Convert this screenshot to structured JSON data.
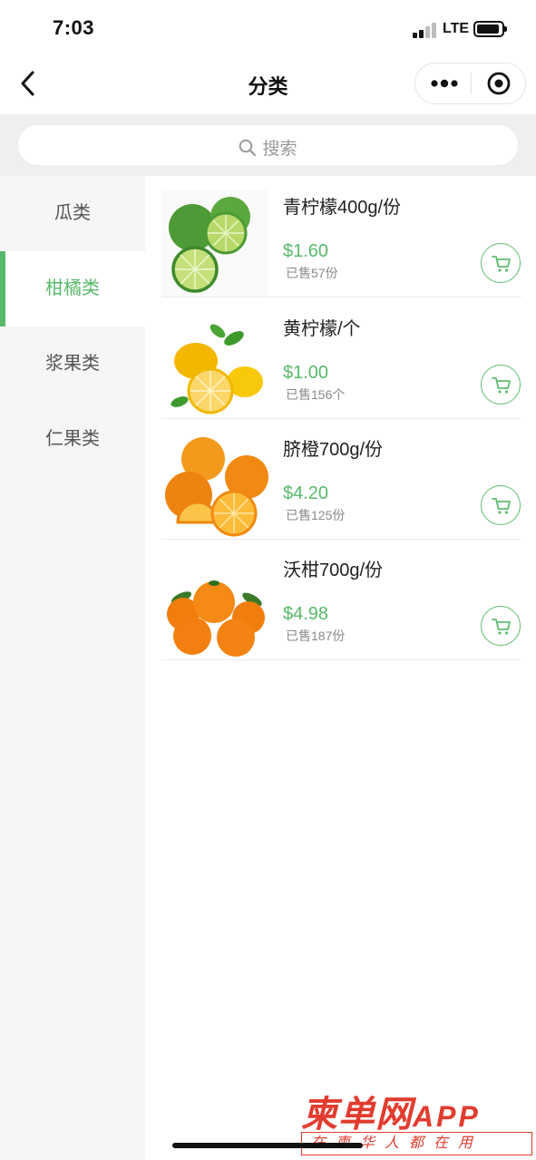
{
  "status_bar": {
    "time": "7:03",
    "network": "LTE"
  },
  "nav": {
    "title": "分类"
  },
  "search": {
    "placeholder": "搜索"
  },
  "categories": [
    {
      "label": "瓜类",
      "active": false
    },
    {
      "label": "柑橘类",
      "active": true
    },
    {
      "label": "浆果类",
      "active": false
    },
    {
      "label": "仁果类",
      "active": false
    }
  ],
  "products": [
    {
      "name": "青柠檬400g/份",
      "price": "$1.60",
      "sold": "已售57份"
    },
    {
      "name": "黄柠檬/个",
      "price": "$1.00",
      "sold": "已售156个"
    },
    {
      "name": "脐橙700g/份",
      "price": "$4.20",
      "sold": "已售125份"
    },
    {
      "name": "沃柑700g/份",
      "price": "$4.98",
      "sold": "已售187份"
    }
  ],
  "watermark": {
    "brand": "柬单网",
    "brand_suffix": "APP",
    "slogan": "在柬华人都在用"
  },
  "colors": {
    "accent": "#58b96a",
    "sidebar_bg": "#f6f6f6",
    "watermark": "#e23c2f"
  },
  "icons": [
    "back-chevron-icon",
    "more-dots-icon",
    "close-target-icon",
    "search-icon",
    "cart-icon"
  ]
}
